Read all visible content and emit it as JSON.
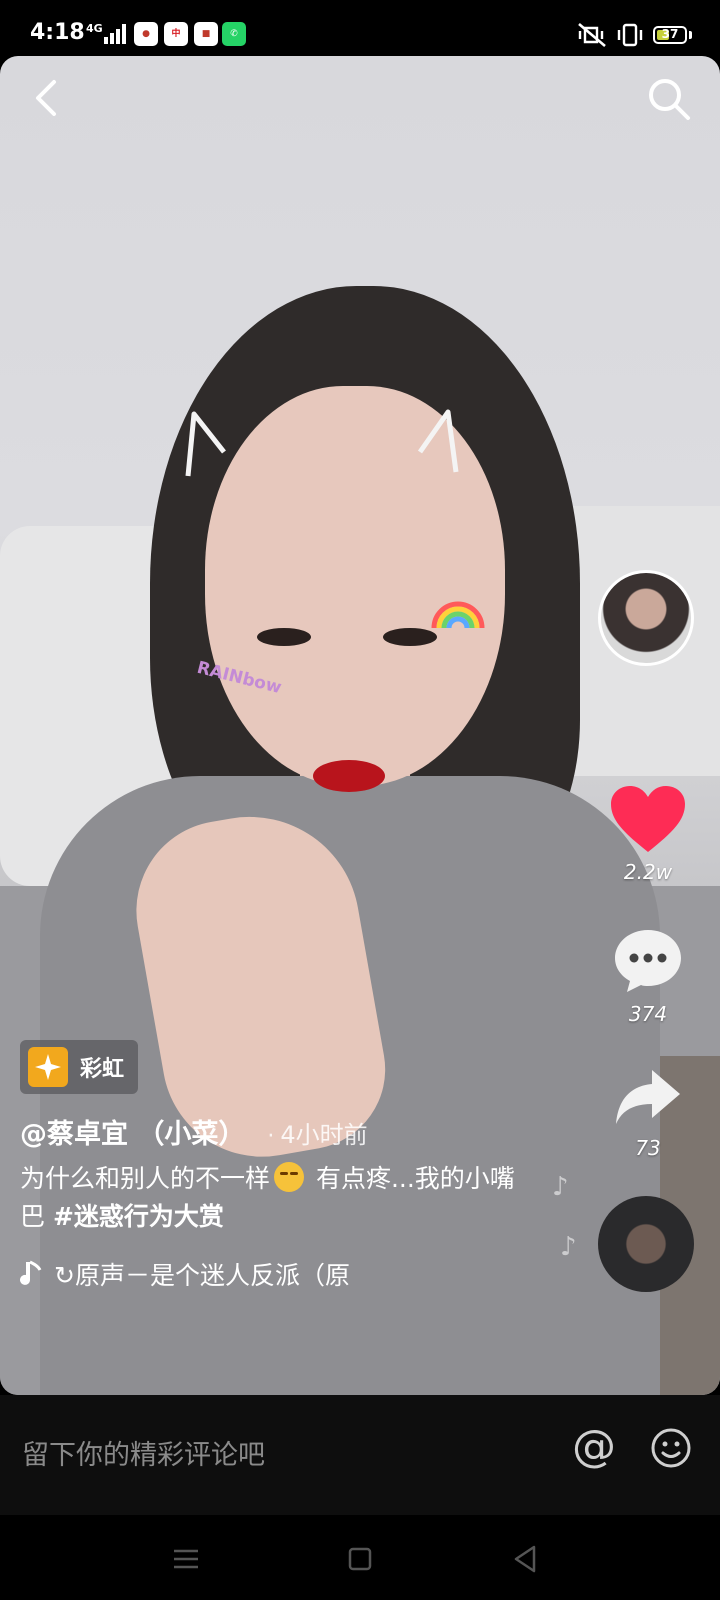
{
  "status_bar": {
    "time": "4:18",
    "network": "4G",
    "battery": "37",
    "apps": [
      {
        "icon": "notification-app-1-icon",
        "label": "",
        "bg": "#ffffff",
        "fg": "#c0392b"
      },
      {
        "icon": "notification-app-2-icon",
        "label": "中",
        "bg": "#ffffff",
        "fg": "#d71920"
      },
      {
        "icon": "notification-app-3-icon",
        "label": "",
        "bg": "#ffffff",
        "fg": "#c0392b"
      },
      {
        "icon": "whatsapp-icon",
        "label": "",
        "bg": "#25d366",
        "fg": "#ffffff"
      }
    ]
  },
  "video": {
    "overlay_sticker": "RAINbow"
  },
  "actions": {
    "like_count": "2.2w",
    "comment_count": "374",
    "share_count": "73",
    "like_color": "#fe2c55"
  },
  "info": {
    "tag_label": "彩虹",
    "author": "@蔡卓宜 （小菜）",
    "time_separator": "·",
    "time_ago": "4小时前",
    "caption_part1": "为什么和别人的不一样",
    "caption_part2": " 有点疼...我的小嘴巴 ",
    "hashtag": "#迷惑行为大赏",
    "music": "↻原声－是个迷人反派（原"
  },
  "comment_bar": {
    "placeholder": "留下你的精彩评论吧",
    "at_symbol": "@"
  }
}
